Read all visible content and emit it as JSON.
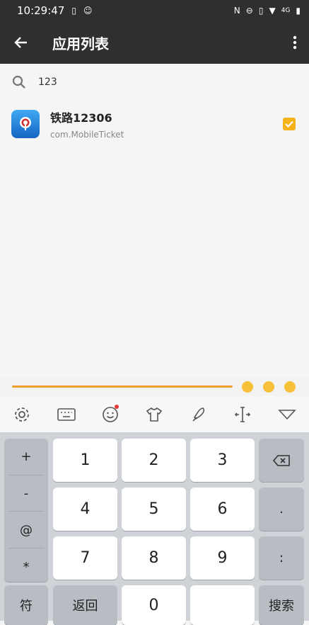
{
  "status_bar": {
    "time": "10:29:47",
    "network": "4G"
  },
  "app_bar": {
    "title": "应用列表"
  },
  "search": {
    "value": "123"
  },
  "app_list": [
    {
      "name": "铁路12306",
      "package": "com.MobileTicket",
      "checked": true
    }
  ],
  "keyboard": {
    "symbols": [
      "+",
      "-",
      "@",
      "*"
    ],
    "keys_row1": [
      "1",
      "2",
      "3"
    ],
    "keys_row2": [
      "4",
      "5",
      "6"
    ],
    "keys_row3": [
      "7",
      "8",
      "9"
    ],
    "dot": ".",
    "colon": ":",
    "bottom_left": "符",
    "back_label": "返回",
    "zero": "0",
    "search_label": "搜索"
  },
  "colors": {
    "app_bar": "#2f2f2f",
    "accent": "#f6b21b",
    "keyboard_bg": "#cfd2d7"
  },
  "icons": [
    "back-arrow-icon",
    "more-vert-icon",
    "search-icon",
    "settings-icon",
    "keyboard-icon",
    "emoji-icon",
    "theme-shirt-icon",
    "handwriting-icon",
    "cursor-move-icon",
    "collapse-keyboard-icon",
    "backspace-icon"
  ]
}
